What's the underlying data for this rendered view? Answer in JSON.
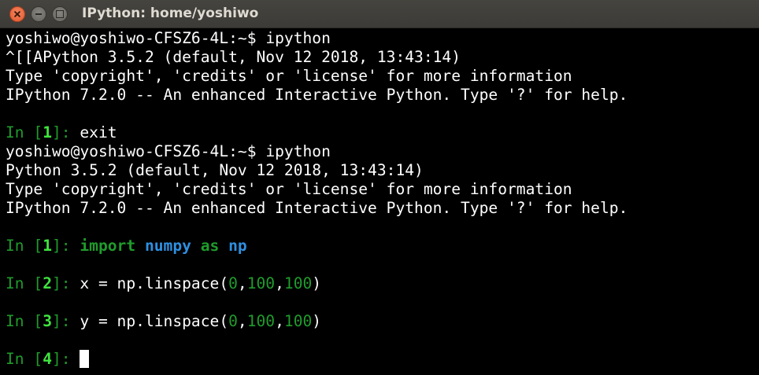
{
  "window": {
    "title": "IPython: home/yoshiwo"
  },
  "terminal": {
    "session1": {
      "shell_prompt": "yoshiwo@yoshiwo-CFSZ6-4L:~$ ",
      "shell_command": "ipython",
      "banner_line1": "^[[APython 3.5.2 (default, Nov 12 2018, 13:43:14)",
      "banner_line2": "Type 'copyright', 'credits' or 'license' for more information",
      "banner_line3": "IPython 7.2.0 -- An enhanced Interactive Python. Type '?' for help.",
      "in1_number": "1",
      "in1_input": "exit"
    },
    "session2": {
      "shell_prompt": "yoshiwo@yoshiwo-CFSZ6-4L:~$ ",
      "shell_command": "ipython",
      "banner_line1": "Python 3.5.2 (default, Nov 12 2018, 13:43:14)",
      "banner_line2": "Type 'copyright', 'credits' or 'license' for more information",
      "banner_line3": "IPython 7.2.0 -- An enhanced Interactive Python. Type '?' for help.",
      "cells": [
        {
          "number": "1",
          "tokens": {
            "import": "import",
            "module": "numpy",
            "as": "as",
            "alias": "np"
          }
        },
        {
          "number": "2",
          "tokens": {
            "pre": "x = np.linspace(",
            "a": "0",
            "sep1": ",",
            "b": "100",
            "sep2": ",",
            "c": "100",
            "post": ")"
          }
        },
        {
          "number": "3",
          "tokens": {
            "pre": "y = np.linspace(",
            "a": "0",
            "sep1": ",",
            "b": "100",
            "sep2": ",",
            "c": "100",
            "post": ")"
          }
        },
        {
          "number": "4"
        }
      ]
    },
    "prompt": {
      "in_label": "In [",
      "close": "]",
      "colon": ": "
    }
  }
}
